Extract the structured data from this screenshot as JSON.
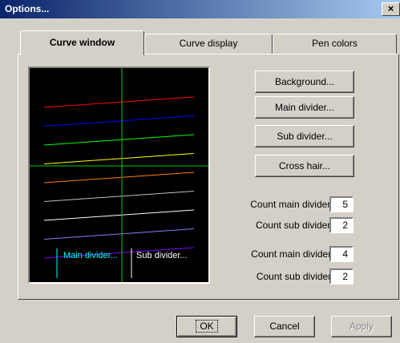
{
  "window": {
    "title": "Options...",
    "close_glyph": "×"
  },
  "tabs": [
    {
      "label": "Curve window",
      "active": true
    },
    {
      "label": "Curve display",
      "active": false
    },
    {
      "label": "Pen colors",
      "active": false
    }
  ],
  "preview": {
    "background_color": "#000000",
    "main_divider_color": "#00cc00",
    "sub_divider_color": "#00ff00",
    "curve_colors": [
      "#ff0000",
      "#0000ff",
      "#00ff00",
      "#ffff00",
      "#ff8000",
      "#c0c0c0",
      "#ffffff",
      "#8080ff",
      "#8000ff"
    ],
    "legend_main_label": "Main divider...",
    "legend_sub_label": "Sub divider...",
    "legend_main_color": "#00ffff",
    "legend_sub_color": "#ffffff"
  },
  "buttons": {
    "background": "Background...",
    "main_divider": "Main divider...",
    "sub_divider": "Sub divider...",
    "cross_hair": "Cross hair..."
  },
  "counts": [
    {
      "label": "Count main divider X:",
      "value": "5"
    },
    {
      "label": "Count sub divider X:",
      "value": "2"
    },
    {
      "label": "Count main divider Y:",
      "value": "4"
    },
    {
      "label": "Count sub divider Y:",
      "value": "2"
    }
  ],
  "footer": {
    "ok": "OK",
    "cancel": "Cancel",
    "apply": "Apply"
  }
}
